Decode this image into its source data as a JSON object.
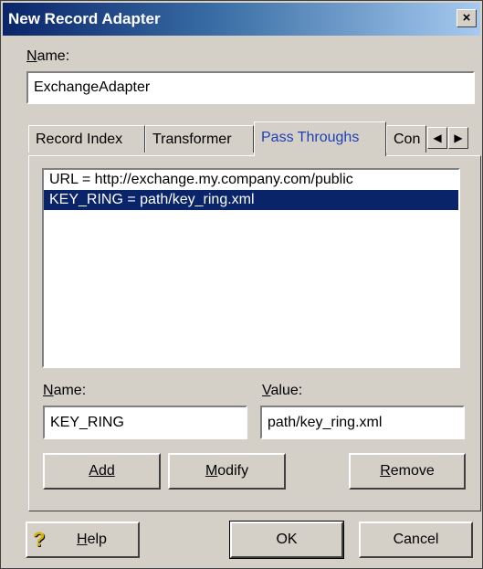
{
  "window": {
    "title": "New Record Adapter",
    "close_glyph": "×"
  },
  "name_field": {
    "label": "Name:",
    "value": "ExchangeAdapter"
  },
  "tabs": [
    {
      "label": "Record Index",
      "active": false
    },
    {
      "label": "Transformer",
      "active": false
    },
    {
      "label": "Pass Throughs",
      "active": true
    },
    {
      "label": "Con",
      "active": false
    }
  ],
  "tab_scroll": {
    "left_icon": "triangle-left-icon",
    "right_icon": "triangle-right-icon"
  },
  "pass_throughs": {
    "items": [
      {
        "text": "URL = http://exchange.my.company.com/public",
        "selected": false
      },
      {
        "text": "KEY_RING = path/key_ring.xml",
        "selected": true
      }
    ],
    "name_label": "Name:",
    "name_value": "KEY_RING",
    "value_label": "Value:",
    "value_value": "path/key_ring.xml",
    "add_label": "Add",
    "modify_label": "Modify",
    "remove_label": "Remove"
  },
  "footer": {
    "help_icon": "question-mark-icon",
    "help_label": "Help",
    "ok_label": "OK",
    "cancel_label": "Cancel"
  },
  "colors": {
    "selection": "#0a246a",
    "active_tab_text": "#1f3fb5",
    "dialog_face": "#d4d0c8"
  }
}
